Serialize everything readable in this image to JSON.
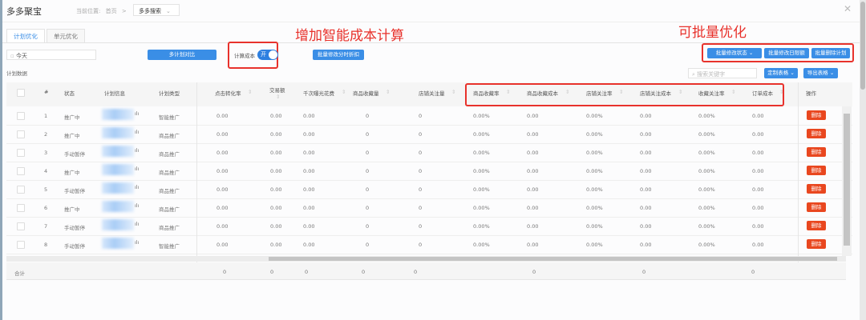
{
  "header": {
    "title": "多多聚宝",
    "breadcrumb_label": "当前位置:",
    "breadcrumb_home": "首页",
    "breadcrumb_sep": ">",
    "breadcrumb_current": "多多搜索",
    "close_icon": "close-icon"
  },
  "tabs": [
    {
      "label": "计划优化",
      "active": true
    },
    {
      "label": "单元优化",
      "active": false
    }
  ],
  "toolbar": {
    "date_value": "今天",
    "compare_button": "多计划对比",
    "cost_calc_label": "计算成本",
    "cost_calc_toggle": "开",
    "cost_calc_on": true,
    "batch_discount_button": "批量修改分时折扣",
    "batch_status_button": "批量修改状态",
    "batch_budget_button": "批量修改日限额",
    "batch_delete_button": "批量删除计划",
    "search_placeholder": "搜索关键字",
    "custom_table_button": "定制表格",
    "export_table_button": "导出表格",
    "section_label": "计划数据"
  },
  "annotations": {
    "smart_cost": "增加智能成本计算",
    "batch_optimize": "可批量优化"
  },
  "colors": {
    "primary": "#3a8ee6",
    "danger": "#e9471f",
    "annotation": "#e8322c"
  },
  "table": {
    "columns": [
      "#",
      "状态",
      "计划信息",
      "计划类型",
      "点击转化率",
      "交易额",
      "千次曝光花费",
      "商品收藏量",
      "店铺关注量",
      "商品收藏率",
      "商品收藏成本",
      "店铺关注率",
      "店铺关注成本",
      "收藏关注率",
      "订单成本",
      "操作"
    ],
    "rows": [
      {
        "index": "1",
        "status": "推广中",
        "type": "智能推广",
        "values": [
          "0.00",
          "0.00",
          "0.00",
          "0",
          "0",
          "0.00%",
          "0.00",
          "0.00%",
          "0.00",
          "0.00%",
          "0.00"
        ]
      },
      {
        "index": "2",
        "status": "推广中",
        "type": "商品推广",
        "values": [
          "0.00",
          "0.00",
          "0.00",
          "0",
          "0",
          "0.00%",
          "0.00",
          "0.00%",
          "0.00",
          "0.00%",
          "0.00"
        ]
      },
      {
        "index": "3",
        "status": "手动暂停",
        "type": "商品推广",
        "values": [
          "0.00",
          "0.00",
          "0.00",
          "0",
          "0",
          "0.00%",
          "0.00",
          "0.00%",
          "0.00",
          "0.00%",
          "0.00"
        ]
      },
      {
        "index": "4",
        "status": "推广中",
        "type": "商品推广",
        "values": [
          "0.00",
          "0.00",
          "0.00",
          "0",
          "0",
          "0.00%",
          "0.00",
          "0.00%",
          "0.00",
          "0.00%",
          "0.00"
        ]
      },
      {
        "index": "5",
        "status": "手动暂停",
        "type": "商品推广",
        "values": [
          "0.00",
          "0.00",
          "0.00",
          "0",
          "0",
          "0.00%",
          "0.00",
          "0.00%",
          "0.00",
          "0.00%",
          "0.00"
        ]
      },
      {
        "index": "6",
        "status": "推广中",
        "type": "商品推广",
        "values": [
          "0.00",
          "0.00",
          "0.00",
          "0",
          "0",
          "0.00%",
          "0.00",
          "0.00%",
          "0.00",
          "0.00%",
          "0.00"
        ]
      },
      {
        "index": "7",
        "status": "手动暂停",
        "type": "商品推广",
        "values": [
          "0.00",
          "0.00",
          "0.00",
          "0",
          "0",
          "0.00%",
          "0.00",
          "0.00%",
          "0.00",
          "0.00%",
          "0.00"
        ]
      },
      {
        "index": "8",
        "status": "手动暂停",
        "type": "智能推广",
        "values": [
          "0.00",
          "0.00",
          "0.00",
          "0",
          "0",
          "0.00%",
          "0.00",
          "0.00%",
          "0.00",
          "0.00%",
          "0.00"
        ]
      }
    ],
    "delete_label": "删除",
    "totals_label": "合计",
    "totals": [
      "0",
      "0",
      "0",
      "0",
      "0",
      "",
      "0",
      "",
      "0",
      "",
      "0"
    ]
  }
}
